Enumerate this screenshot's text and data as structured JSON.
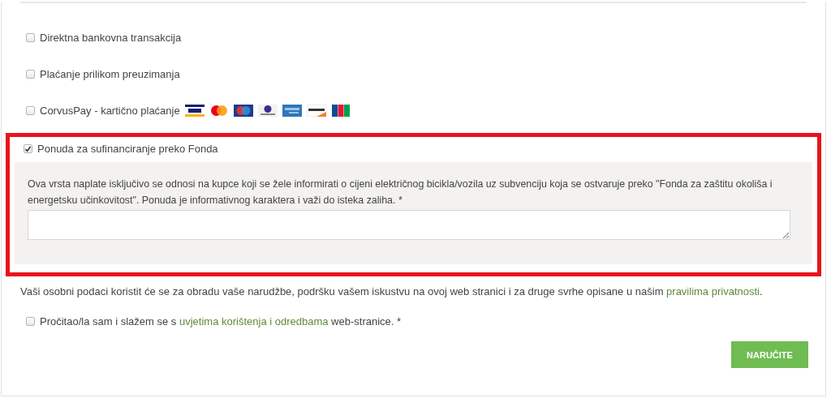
{
  "payment_options": [
    {
      "label": "Direktna bankovna transakcija",
      "checked": false
    },
    {
      "label": "Plaćanje prilikom preuzimanja",
      "checked": false
    },
    {
      "label": "CorvusPay - kartično plaćanje",
      "checked": false,
      "card_logos": [
        {
          "kind": "visa"
        },
        {
          "kind": "mastercard"
        },
        {
          "kind": "maestro"
        },
        {
          "kind": "diners"
        },
        {
          "kind": "amex"
        },
        {
          "kind": "discover"
        },
        {
          "kind": "jcb"
        }
      ]
    },
    {
      "label": "Ponuda za sufinanciranje preko Fonda",
      "checked": true,
      "highlighted": true,
      "description": "Ova vrsta naplate isključivo se odnosi na kupce koji se žele informirati o cijeni električnog bicikla/vozila uz subvenciju koja se ostvaruje preko \"Fonda za zaštitu okoliša i energetsku učinkovitost\". Ponuda je informativnog karaktera i važi do isteka zaliha. *"
    }
  ],
  "privacy_notice": {
    "text": "Vaši osobni podaci koristit će se za obradu vaše narudžbe, podršku vašem iskustvu na ovoj web stranici i za druge svrhe opisane u našim ",
    "link": "pravilima privatnosti",
    "after": "."
  },
  "terms": {
    "checked": false,
    "before": "Pročitao/la sam i slažem se s ",
    "link": "uvjetima korištenja i odredbama",
    "after": " web-stranice. *"
  },
  "submit_button": "NARUČITE"
}
